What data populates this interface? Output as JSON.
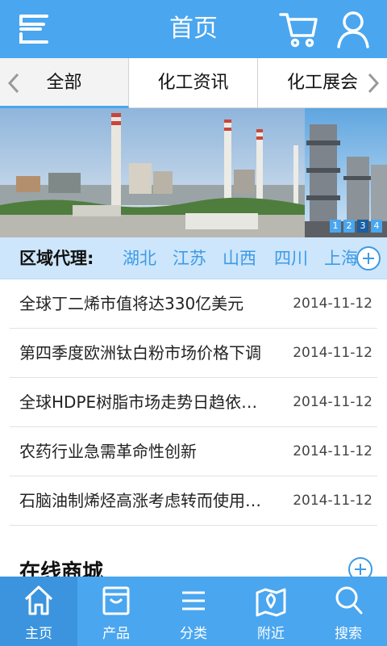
{
  "header": {
    "title": "首页",
    "icons": [
      "menu-icon",
      "cart-icon",
      "user-icon"
    ]
  },
  "tabs": {
    "items": [
      {
        "label": "全部"
      },
      {
        "label": "化工资讯"
      },
      {
        "label": "化工展会"
      }
    ]
  },
  "banner": {
    "pages": [
      "1",
      "2",
      "3",
      "4"
    ],
    "current_page": "3"
  },
  "region": {
    "label": "区域代理:",
    "items": [
      "湖北",
      "江苏",
      "山西",
      "四川",
      "上海"
    ]
  },
  "news": [
    {
      "title": "全球丁二烯市值将达330亿美元",
      "date": "2014-11-12"
    },
    {
      "title": "第四季度欧洲钛白粉市场价格下调",
      "date": "2014-11-12"
    },
    {
      "title": "全球HDPE树脂市场走势日趋依…",
      "date": "2014-11-12"
    },
    {
      "title": "农药行业急需革命性创新",
      "date": "2014-11-12"
    },
    {
      "title": "石脑油制烯烃高涨考虑转而使用…",
      "date": "2014-11-12"
    }
  ],
  "mall": {
    "title": "在线商城"
  },
  "bottom_nav": {
    "items": [
      {
        "label": "主页",
        "icon": "home-icon"
      },
      {
        "label": "产品",
        "icon": "bag-icon"
      },
      {
        "label": "分类",
        "icon": "list-icon"
      },
      {
        "label": "附近",
        "icon": "map-icon"
      },
      {
        "label": "搜索",
        "icon": "search-icon"
      }
    ]
  },
  "colors": {
    "primary": "#4aa6ef",
    "region_bg": "#cde6fb",
    "accent_text": "#3d9ae6"
  }
}
